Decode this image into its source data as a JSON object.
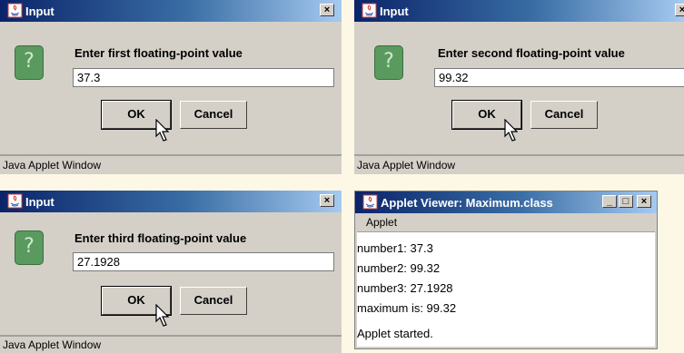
{
  "dialogs": [
    {
      "title": "Input",
      "close": "×",
      "prompt": "Enter first floating-point value",
      "value": "37.3",
      "ok": "OK",
      "cancel": "Cancel",
      "status": "Java Applet Window"
    },
    {
      "title": "Input",
      "close": "×",
      "prompt": "Enter second floating-point value",
      "value": "99.32",
      "ok": "OK",
      "cancel": "Cancel",
      "status": "Java Applet Window"
    },
    {
      "title": "Input",
      "close": "×",
      "prompt": "Enter third floating-point value",
      "value": "27.1928",
      "ok": "OK",
      "cancel": "Cancel",
      "status": "Java Applet Window"
    }
  ],
  "viewer": {
    "title": "Applet Viewer: Maximum.class",
    "minimize": "_",
    "maximize": "□",
    "close": "×",
    "menu": "Applet",
    "lines": [
      "number1: 37.3",
      "number2: 99.32",
      "number3: 27.1928",
      "maximum is: 99.32"
    ],
    "status": "Applet started."
  },
  "icons": {
    "question": "?"
  }
}
